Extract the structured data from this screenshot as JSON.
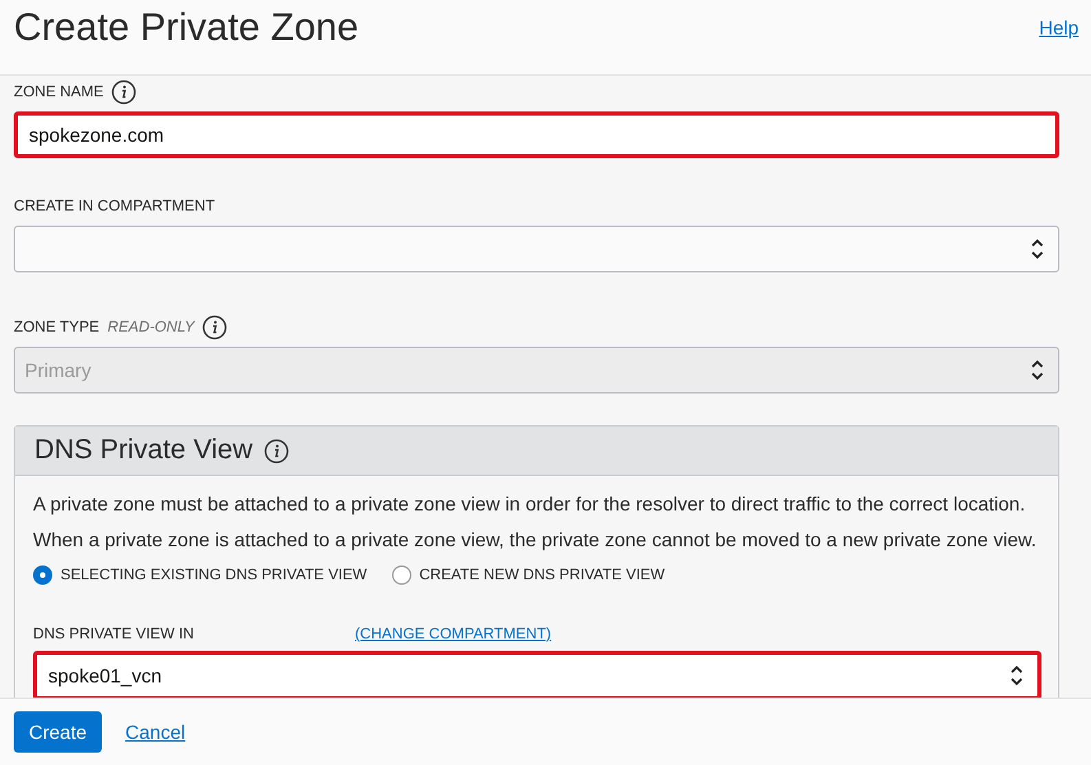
{
  "header": {
    "title": "Create Private Zone",
    "help_link": "Help"
  },
  "fields": [
    {
      "kind": "text",
      "label": "ZONE NAME",
      "info": true,
      "value": "spokezone.com",
      "highlighted": true,
      "disabled": false
    },
    {
      "kind": "select",
      "label": "CREATE IN COMPARTMENT",
      "info": false,
      "highlighted": false,
      "disabled": false
    },
    {
      "kind": "select",
      "label": "ZONE TYPE",
      "note": "READ-ONLY",
      "info": true,
      "value": "Primary",
      "highlighted": false,
      "disabled": true
    }
  ],
  "dns_panel": {
    "title": "DNS Private View",
    "paragraphs": [
      "A private zone must be attached to a private zone view in order for the resolver to direct traffic to the correct location.",
      "When a private zone is attached to a private zone view, the private zone cannot be moved to a new private zone view."
    ],
    "options": [
      {
        "label": "SELECTING EXISTING DNS PRIVATE VIEW",
        "selected": true
      },
      {
        "label": "CREATE NEW DNS PRIVATE VIEW",
        "selected": false
      }
    ],
    "view_field": {
      "label": "DNS PRIVATE VIEW IN",
      "link": "(CHANGE COMPARTMENT)",
      "value": "spoke01_vcn",
      "highlighted": true
    }
  },
  "footer": {
    "buttons": [
      {
        "label": "Create",
        "kind": "primary"
      },
      {
        "label": "Cancel",
        "kind": "link"
      }
    ]
  }
}
